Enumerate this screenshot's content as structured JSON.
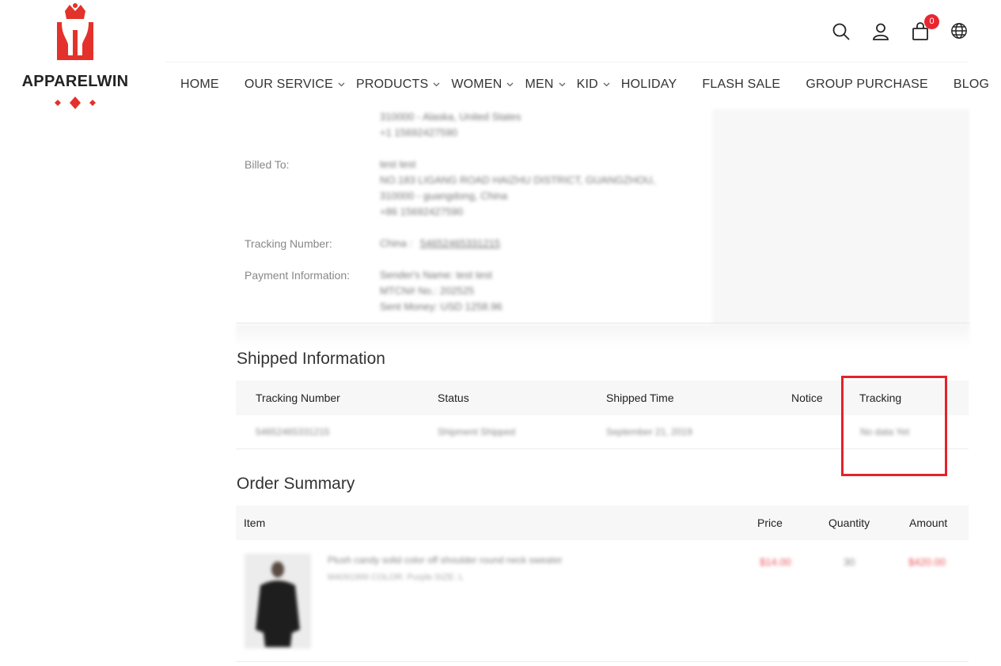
{
  "brand": {
    "name": "APPARELWIN",
    "accent": "#e3322b"
  },
  "top_icons": {
    "search": "search-icon",
    "user": "user-icon",
    "cart": "cart-icon",
    "cart_count": "0",
    "language": "globe-icon"
  },
  "nav": {
    "items": [
      {
        "label": "HOME",
        "dropdown": false
      },
      {
        "label": "OUR SERVICE",
        "dropdown": true
      },
      {
        "label": "PRODUCTS",
        "dropdown": true
      },
      {
        "label": "WOMEN",
        "dropdown": true
      },
      {
        "label": "MEN",
        "dropdown": true
      },
      {
        "label": "KID",
        "dropdown": true
      },
      {
        "label": "HOLIDAY",
        "dropdown": false
      },
      {
        "label": "FLASH SALE",
        "dropdown": false
      },
      {
        "label": "GROUP PURCHASE",
        "dropdown": false
      },
      {
        "label": "BLOG",
        "dropdown": false
      }
    ]
  },
  "order_info": {
    "ship_to_lines": [
      "310000 - Alaska, United States",
      "+1 15692427590"
    ],
    "billed_to_label": "Billed To:",
    "billed_to_lines": [
      "test test",
      "NO.183 LIGANG ROAD HAIZHU DISTRICT, GUANGZHOU,",
      "310000 - guangdong, China",
      "+86 15692427590"
    ],
    "tracking_label": "Tracking Number:",
    "tracking_prefix": "China :",
    "tracking_value": "5465246533121​5",
    "payment_label": "Payment Information:",
    "payment_lines": [
      "Sender's Name: test test",
      "MTCN# No.: 202525",
      "Sent Money: USD 1258.96"
    ]
  },
  "shipped": {
    "title": "Shipped Information",
    "headers": {
      "tracking_number": "Tracking Number",
      "status": "Status",
      "shipped_time": "Shipped Time",
      "notice": "Notice",
      "tracking": "Tracking"
    },
    "row": {
      "tracking_number": "5465246533121​5",
      "status": "Shipment Shipped",
      "shipped_time": "September 21, 2019",
      "notice": "",
      "tracking": "No data Yet"
    }
  },
  "summary": {
    "title": "Order Summary",
    "headers": {
      "item": "Item",
      "price": "Price",
      "quantity": "Quantity",
      "amount": "Amount"
    },
    "product": {
      "name": "Plush candy solid color off shoulder round neck sweater",
      "meta": "M4091999   COLOR: Purple  SIZE: L",
      "price": "$14.00",
      "quantity": "30",
      "amount": "$420.00"
    }
  },
  "colors": {
    "highlight_box": "#e3222b",
    "price": "#e8525a"
  }
}
